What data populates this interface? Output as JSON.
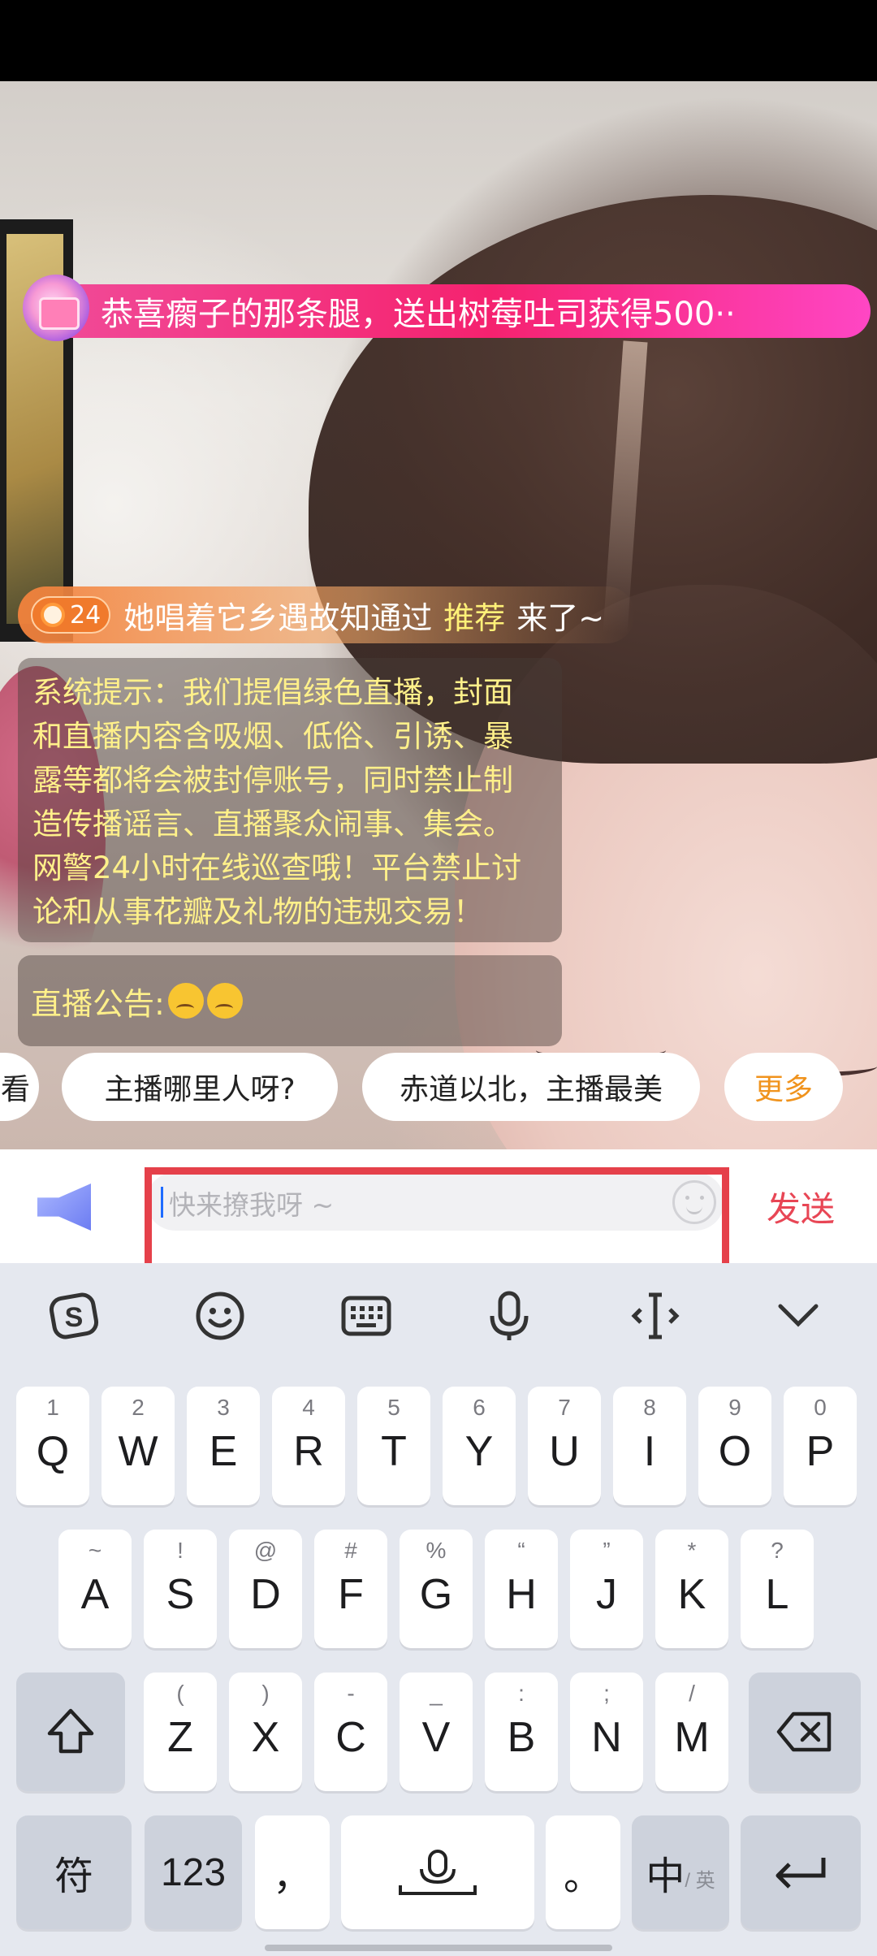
{
  "gift_banner": {
    "text": "恭喜瘸子的那条腿，送出树莓吐司获得500··"
  },
  "entry_message": {
    "level": "24",
    "username": "她唱着它乡遇故知通过",
    "highlight": "推荐",
    "tail": "来了~"
  },
  "system_notice": {
    "lines": [
      "系统提示：我们提倡绿色直播，封面",
      "和直播内容含吸烟、低俗、引诱、暴",
      "露等都将会被封停账号，同时禁止制",
      "造传播谣言、直播聚众闹事、集会。",
      "网警24小时在线巡查哦！平台禁止讨",
      "论和从事花瓣及礼物的违规交易！"
    ]
  },
  "announcement": {
    "label": "直播公告:"
  },
  "quick_chips": {
    "partial": "看",
    "chip1": "主播哪里人呀?",
    "chip2": "赤道以北，主播最美",
    "more": "更多"
  },
  "input_bar": {
    "placeholder": "快来撩我呀 ~",
    "send": "发送",
    "left_icon": "megaphone-icon",
    "right_icon": "emoji-icon"
  },
  "keyboard": {
    "toolbar": [
      "sogou-logo-icon",
      "emoji-icon",
      "keyboard-icon",
      "microphone-icon",
      "cursor-icon",
      "collapse-icon"
    ],
    "row1": [
      {
        "sup": "1",
        "key": "Q"
      },
      {
        "sup": "2",
        "key": "W"
      },
      {
        "sup": "3",
        "key": "E"
      },
      {
        "sup": "4",
        "key": "R"
      },
      {
        "sup": "5",
        "key": "T"
      },
      {
        "sup": "6",
        "key": "Y"
      },
      {
        "sup": "7",
        "key": "U"
      },
      {
        "sup": "8",
        "key": "I"
      },
      {
        "sup": "9",
        "key": "O"
      },
      {
        "sup": "0",
        "key": "P"
      }
    ],
    "row2": [
      {
        "sup": "~",
        "key": "A"
      },
      {
        "sup": "!",
        "key": "S"
      },
      {
        "sup": "@",
        "key": "D"
      },
      {
        "sup": "#",
        "key": "F"
      },
      {
        "sup": "%",
        "key": "G"
      },
      {
        "sup": "“",
        "key": "H"
      },
      {
        "sup": "”",
        "key": "J"
      },
      {
        "sup": "*",
        "key": "K"
      },
      {
        "sup": "?",
        "key": "L"
      }
    ],
    "row3": [
      {
        "sup": "(",
        "key": "Z"
      },
      {
        "sup": ")",
        "key": "X"
      },
      {
        "sup": "-",
        "key": "C"
      },
      {
        "sup": "_",
        "key": "V"
      },
      {
        "sup": ":",
        "key": "B"
      },
      {
        "sup": ";",
        "key": "N"
      },
      {
        "sup": "/",
        "key": "M"
      }
    ],
    "bottom": {
      "symbols": "符",
      "numbers": "123",
      "comma": "，",
      "period": "。",
      "lang_main": "中",
      "lang_sub": "/ 英"
    }
  }
}
